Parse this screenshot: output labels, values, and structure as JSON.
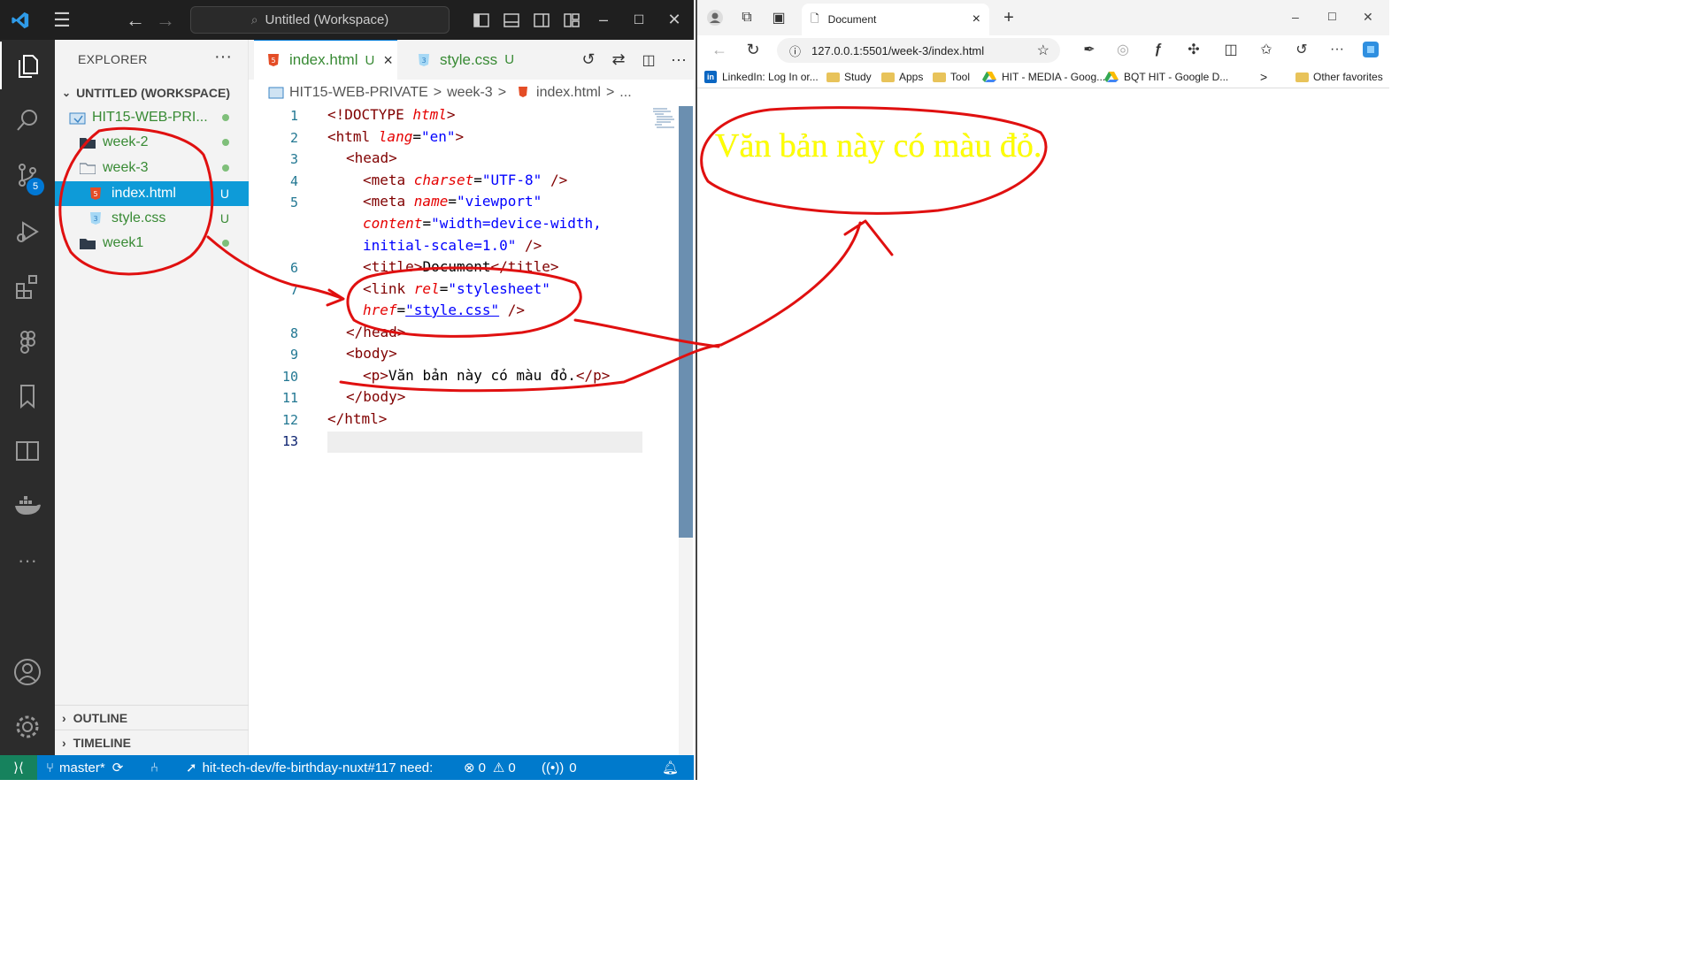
{
  "vscode": {
    "titlebar": {
      "command_center": "Untitled (Workspace)"
    },
    "activity": {
      "scm_badge": "5"
    },
    "sidebar": {
      "title": "EXPLORER",
      "more": "···",
      "workspace": "UNTITLED (WORKSPACE)",
      "tree": [
        {
          "label": "HIT15-WEB-PRI...",
          "status": ""
        },
        {
          "label": "week-2",
          "status": ""
        },
        {
          "label": "week-3",
          "status": ""
        },
        {
          "label": "index.html",
          "status": "U"
        },
        {
          "label": "style.css",
          "status": "U"
        },
        {
          "label": "week1",
          "status": ""
        }
      ],
      "outline": "OUTLINE",
      "timeline": "TIMELINE"
    },
    "tabs": [
      {
        "name": "index.html",
        "status": "U",
        "close": "×"
      },
      {
        "name": "style.css",
        "status": "U"
      }
    ],
    "breadcrumbs": [
      "HIT15-WEB-PRIVATE",
      ">",
      "week-3",
      ">",
      "index.html",
      ">",
      "..."
    ],
    "line_numbers": [
      "1",
      "2",
      "3",
      "4",
      "5",
      "",
      "",
      "6",
      "7",
      "",
      "8",
      "9",
      "10",
      "11",
      "12",
      "13"
    ],
    "code": {
      "l1_a": "<!DOCTYPE ",
      "l1_b": "html",
      "l1_c": ">",
      "l2_a": "<html ",
      "l2_b": "lang",
      "l2_c": "=",
      "l2_d": "\"en\"",
      "l2_e": ">",
      "l3": "<head>",
      "l4_a": "<meta ",
      "l4_b": "charset",
      "l4_c": "=",
      "l4_d": "\"UTF-8\"",
      "l4_e": " />",
      "l5_a": "<meta ",
      "l5_b": "name",
      "l5_c": "=",
      "l5_d": "\"viewport\"",
      "l5w1_a": "content",
      "l5w1_b": "=",
      "l5w1_c": "\"width=device-width,",
      "l5w2_a": "initial-scale=1.0\"",
      "l5w2_b": " />",
      "l6_a": "<title>",
      "l6_b": "Document",
      "l6_c": "</title>",
      "l7_a": "<link ",
      "l7_b": "rel",
      "l7_c": "=",
      "l7_d": "\"stylesheet\"",
      "l7w_a": "href",
      "l7w_b": "=",
      "l7w_c": "\"style.css\"",
      "l7w_d": " />",
      "l8": "</head>",
      "l9": "<body>",
      "l10_a": "<p>",
      "l10_b": "Văn bản này có màu đỏ.",
      "l10_c": "</p>",
      "l11": "</body>",
      "l12": "</html>"
    },
    "statusbar": {
      "branch": "master*",
      "task": "hit-tech-dev/fe-birthday-nuxt#117 need:",
      "errors": "0",
      "warnings": "0",
      "ports": "0"
    }
  },
  "browser": {
    "tab_title": "Document",
    "tab_close": "×",
    "new_tab": "+",
    "address": "127.0.0.1:5501/week-3/index.html",
    "favorites": [
      {
        "label": "LinkedIn: Log In or...",
        "icon": "linkedin-icon"
      },
      {
        "label": "Study",
        "icon": "folder-icon"
      },
      {
        "label": "Apps",
        "icon": "folder-icon"
      },
      {
        "label": "Tool",
        "icon": "folder-icon"
      },
      {
        "label": "HIT - MEDIA - Goog...",
        "icon": "google-drive-icon"
      },
      {
        "label": "BQT HIT - Google D...",
        "icon": "google-drive-icon"
      }
    ],
    "favorites_more": ">",
    "other_favorites": "Other favorites",
    "page_text": "Văn bản này có màu đỏ.",
    "page_text_color": "#ffff00"
  },
  "colors": {
    "accent": "#007acc",
    "selection": "#0e9bd8",
    "untracked": "#388a34",
    "annotation": "#e01010"
  }
}
